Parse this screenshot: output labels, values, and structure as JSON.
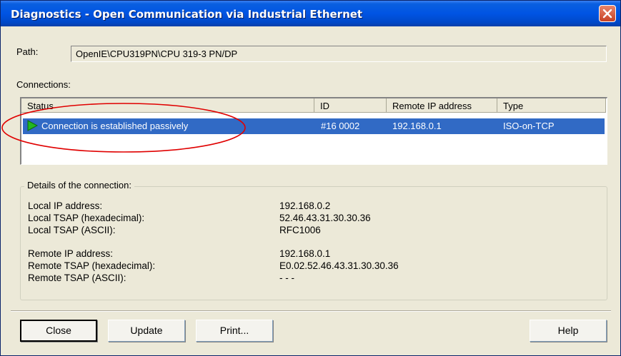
{
  "window": {
    "title": "Diagnostics - Open Communication via Industrial Ethernet"
  },
  "path": {
    "label": "Path:",
    "value": "OpenIE\\CPU319PN\\CPU 319-3 PN/DP"
  },
  "connections": {
    "label": "Connections:",
    "columns": [
      "Status",
      "ID",
      "Remote IP address",
      "Type"
    ],
    "rows": [
      {
        "status": "Connection is established passively",
        "id": "#16 0002",
        "remote_ip": "192.168.0.1",
        "type": "ISO-on-TCP",
        "selected": true
      }
    ]
  },
  "details": {
    "legend": "Details of the connection:",
    "local_ip_label": "Local IP address:",
    "local_ip": "192.168.0.2",
    "local_tsap_hex_label": "Local TSAP (hexadecimal):",
    "local_tsap_hex": "52.46.43.31.30.30.36",
    "local_tsap_ascii_label": "Local TSAP (ASCII):",
    "local_tsap_ascii": "RFC1006",
    "remote_ip_label": "Remote IP address:",
    "remote_ip": "192.168.0.1",
    "remote_tsap_hex_label": "Remote TSAP (hexadecimal):",
    "remote_tsap_hex": "E0.02.52.46.43.31.30.30.36",
    "remote_tsap_ascii_label": "Remote TSAP (ASCII):",
    "remote_tsap_ascii": "- - -"
  },
  "buttons": {
    "close": "Close",
    "update": "Update",
    "print": "Print...",
    "help": "Help"
  },
  "colors": {
    "titlebar": "#0054e3",
    "selection": "#316ac5",
    "status_ok": "#22b822",
    "annotation": "#e00000"
  }
}
